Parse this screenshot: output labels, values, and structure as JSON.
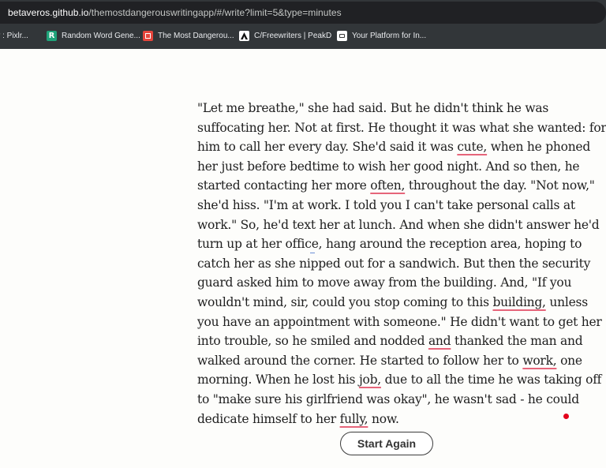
{
  "browser": {
    "url_host": "betaveros.github.io",
    "url_path": "/themostdangerouswritingapp/#/write?limit=5&type=minutes",
    "bookmarks": [
      {
        "label": "r : Pixlr...",
        "icon": "none"
      },
      {
        "label": "Random Word Gene...",
        "icon": "r-logo-icon"
      },
      {
        "label": "The Most Dangerou...",
        "icon": "red-square-icon"
      },
      {
        "label": "C/Freewriters | PeakD",
        "icon": "peakd-icon"
      },
      {
        "label": "Your Platform for In...",
        "icon": "document-icon"
      }
    ]
  },
  "editor": {
    "lines": [
      [
        {
          "t": "\"Let me breathe,\" she had said. But he didn't think he was"
        }
      ],
      [
        {
          "t": "suffocating her. Not at first. He thought it was what she wanted: for"
        }
      ],
      [
        {
          "t": "him to call her every day. She'd said it was "
        },
        {
          "t": "cute,",
          "u": true
        },
        {
          "t": " when he phoned"
        }
      ],
      [
        {
          "t": "her just before bedtime to wish her good night. And so then, he"
        }
      ],
      [
        {
          "t": "started contacting her more "
        },
        {
          "t": "often,",
          "u": true
        },
        {
          "t": " throughout the day. \"Not now,\""
        }
      ],
      [
        {
          "t": "she'd hiss. \"I'm at work. I told you I can't take personal calls at"
        }
      ],
      [
        {
          "t": "work.\" So, he'd text her at lunch. And when she didn't answer he'd"
        }
      ],
      [
        {
          "t": "turn up at her office, hang around the reception area, hoping to"
        }
      ],
      [
        {
          "t": "catch her as she nipped out for a sandwich. But then the security"
        }
      ],
      [
        {
          "t": "guard asked him to move away from the building. And, \"If you"
        }
      ],
      [
        {
          "t": "wouldn't mind, sir, could you stop coming to this "
        },
        {
          "t": "building,",
          "u": true
        },
        {
          "t": " unless"
        }
      ],
      [
        {
          "t": "you have an appointment with someone.\" He didn't want to get her"
        }
      ],
      [
        {
          "t": "into trouble, so he smiled and nodded "
        },
        {
          "t": "and",
          "u": true
        },
        {
          "t": " thanked the man and"
        }
      ],
      [
        {
          "t": "walked around the corner. He started to follow her to "
        },
        {
          "t": "work,",
          "u": true
        },
        {
          "t": " one"
        }
      ],
      [
        {
          "t": "morning. When he lost his "
        },
        {
          "t": "job,",
          "u": true
        },
        {
          "t": " due to all the time he was taking off"
        }
      ],
      [
        {
          "t": "to \"make sure his girlfriend was okay\", he wasn't sad - he could"
        }
      ],
      [
        {
          "t": "dedicate himself to her "
        },
        {
          "t": "fully,",
          "u": true
        },
        {
          "t": " now."
        }
      ]
    ]
  },
  "actions": {
    "start_again_label": "Start Again"
  },
  "colors": {
    "spellcheck_underline": "#e6657a",
    "indicator_dot": "#e3001b"
  }
}
